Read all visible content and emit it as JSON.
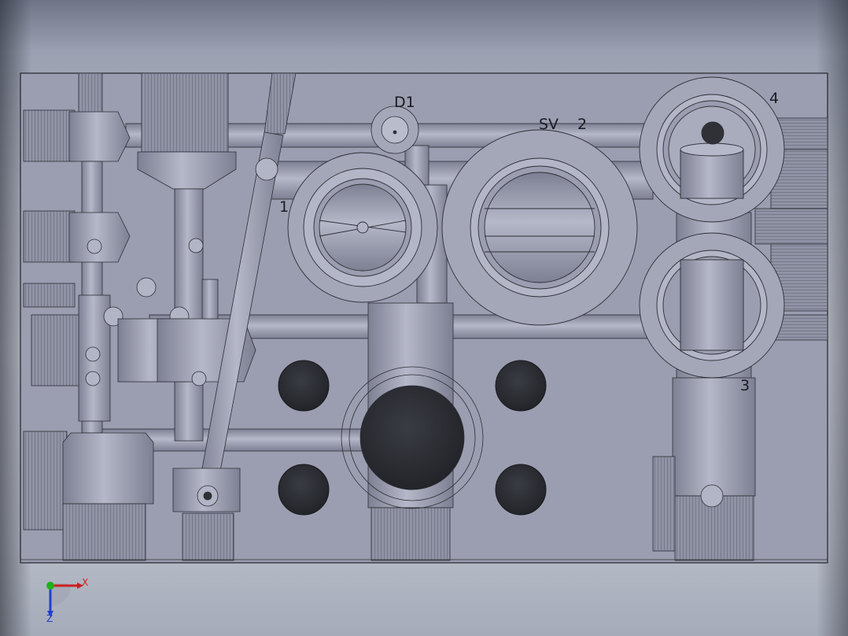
{
  "viewport": {
    "background_top": "#6f7587",
    "background_bottom": "#c4c8d3",
    "part_color": "#9a9db0",
    "dark_hole_color": "#2f3136"
  },
  "annotations": {
    "d1": "D1",
    "sv": "SV",
    "port_2": "2",
    "port_1": "1",
    "port_4": "4",
    "port_3": "3"
  },
  "triad": {
    "x_label": "X",
    "z_label": "Z",
    "x_color": "#cc1f1f",
    "z_color": "#1f3fcc",
    "y_color": "#19b419"
  }
}
